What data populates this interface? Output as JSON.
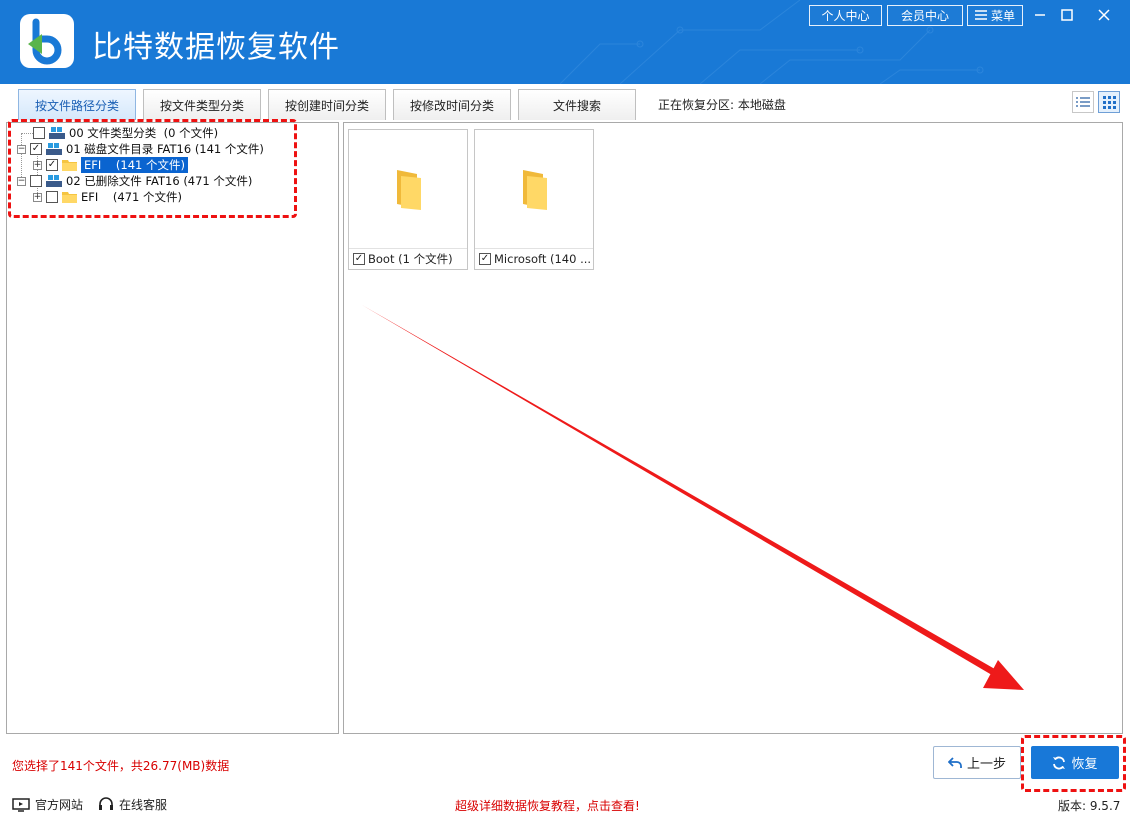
{
  "app": {
    "title": "比特数据恢复软件",
    "personal_center": "个人中心",
    "member_center": "会员中心",
    "menu": "菜单",
    "brand_color": "#1979d6"
  },
  "tabs": [
    {
      "label": "按文件路径分类",
      "active": true
    },
    {
      "label": "按文件类型分类",
      "active": false
    },
    {
      "label": "按创建时间分类",
      "active": false
    },
    {
      "label": "按修改时间分类",
      "active": false
    },
    {
      "label": "文件搜索",
      "active": false
    }
  ],
  "recovering_partition": "正在恢复分区: 本地磁盘",
  "tree": [
    {
      "prefix": "00",
      "label": "文件类型分类",
      "count": "(0 个文件)",
      "checked": false
    },
    {
      "prefix": "01",
      "label": "磁盘文件目录 FAT16",
      "count": "(141 个文件)",
      "checked": true
    },
    {
      "label": "EFI",
      "count": "(141 个文件)",
      "checked": true,
      "selected": true
    },
    {
      "prefix": "02",
      "label": "已删除文件 FAT16",
      "count": "(471 个文件)",
      "checked": false
    },
    {
      "label": "EFI",
      "count": "(471 个文件)",
      "checked": false
    }
  ],
  "cards": [
    {
      "label": "Boot  (1 个文件)",
      "checked": true
    },
    {
      "label": "Microsoft  (140 ...",
      "checked": true
    }
  ],
  "selected_info": "您选择了141个文件，共26.77(MB)数据",
  "buttons": {
    "prev": "上一步",
    "restore": "恢复"
  },
  "footer": {
    "website": "官方网站",
    "support": "在线客服",
    "tutorial": "超级详细数据恢复教程，点击查看!",
    "version": "版本: 9.5.7"
  },
  "colors": {
    "accent": "#1878d8",
    "highlight": "#ee1111",
    "info_text": "#d80000"
  }
}
